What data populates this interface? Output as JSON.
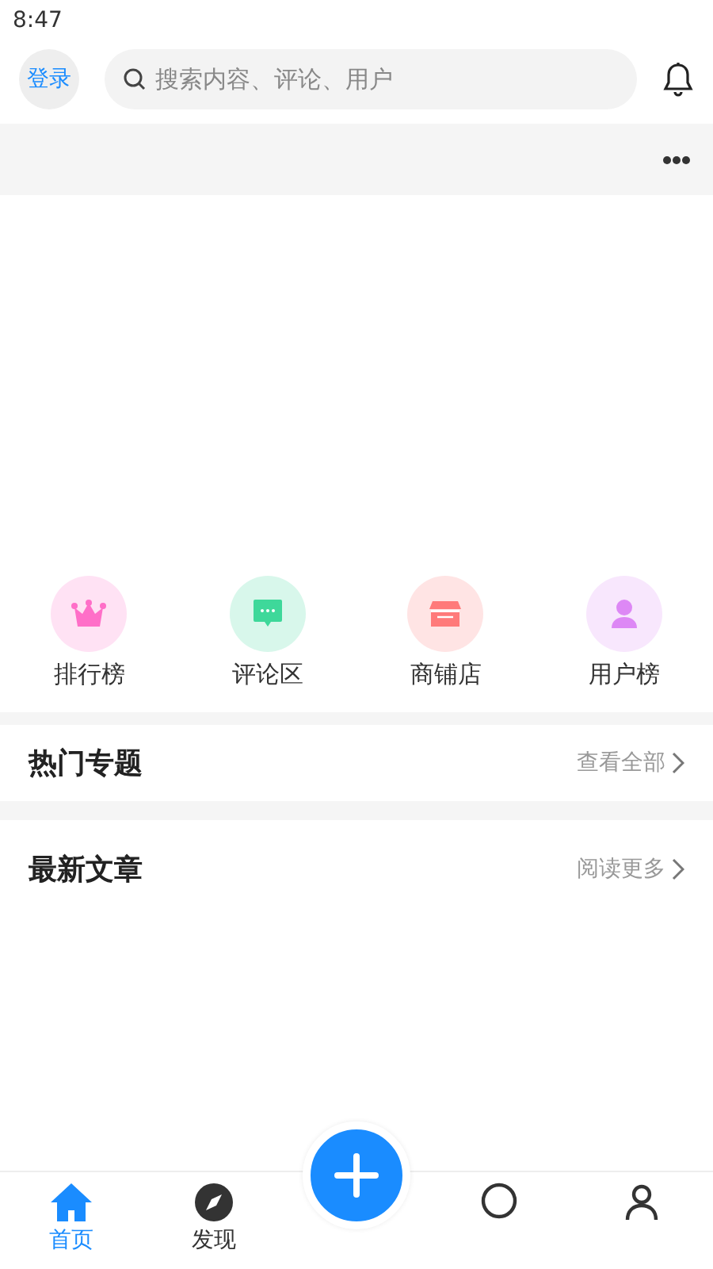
{
  "status_bar": {
    "time": "8:47"
  },
  "header": {
    "login_button": "登录",
    "search": {
      "placeholder": "搜索内容、评论、用户"
    }
  },
  "categories": [
    {
      "kind": "crown",
      "label": "排行榜",
      "color": "#ff6fc8"
    },
    {
      "kind": "chat",
      "label": "评论区",
      "color": "#3ed89a"
    },
    {
      "kind": "shop",
      "label": "商铺店",
      "color": "#ff7a7a"
    },
    {
      "kind": "user",
      "label": "用户榜",
      "color": "#dd88f5"
    }
  ],
  "sections": [
    {
      "title": "热门专题",
      "link": "查看全部"
    },
    {
      "title": "最新文章",
      "link": "阅读更多"
    }
  ],
  "bottom_nav": [
    {
      "kind": "home",
      "label": "首页",
      "selected": true
    },
    {
      "kind": "compass",
      "label": "发现",
      "selected": false
    },
    {
      "kind": "plus",
      "selected": false
    },
    {
      "kind": "message",
      "selected": false
    },
    {
      "kind": "user",
      "selected": false
    }
  ]
}
